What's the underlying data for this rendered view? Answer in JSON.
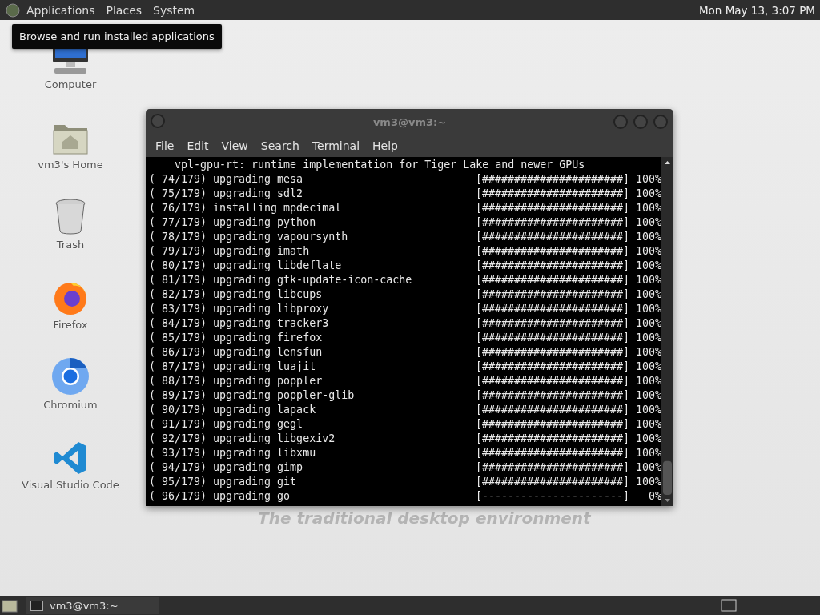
{
  "top_panel": {
    "menus": [
      {
        "label": "Applications",
        "selected": false
      },
      {
        "label": "Places",
        "selected": false
      },
      {
        "label": "System",
        "selected": false
      }
    ],
    "clock": "Mon May 13,  3:07 PM"
  },
  "tooltip": "Browse and run installed applications",
  "desktop_icons": [
    {
      "kind": "computer",
      "label": "Computer"
    },
    {
      "kind": "home",
      "label": "vm3's Home"
    },
    {
      "kind": "trash",
      "label": "Trash"
    },
    {
      "kind": "firefox",
      "label": "Firefox"
    },
    {
      "kind": "chromium",
      "label": "Chromium"
    },
    {
      "kind": "vscode",
      "label": "Visual Studio Code"
    }
  ],
  "wallpaper_text": "The traditional desktop environment",
  "terminal": {
    "title": "vm3@vm3:~",
    "menus": [
      "File",
      "Edit",
      "View",
      "Search",
      "Terminal",
      "Help"
    ],
    "header": "    vpl-gpu-rt: runtime implementation for Tiger Lake and newer GPUs",
    "lines": [
      {
        "text": "( 74/179) upgrading mesa",
        "bar": "[######################]",
        "percent": "100%"
      },
      {
        "text": "( 75/179) upgrading sdl2",
        "bar": "[######################]",
        "percent": "100%"
      },
      {
        "text": "( 76/179) installing mpdecimal",
        "bar": "[######################]",
        "percent": "100%"
      },
      {
        "text": "( 77/179) upgrading python",
        "bar": "[######################]",
        "percent": "100%"
      },
      {
        "text": "( 78/179) upgrading vapoursynth",
        "bar": "[######################]",
        "percent": "100%"
      },
      {
        "text": "( 79/179) upgrading imath",
        "bar": "[######################]",
        "percent": "100%"
      },
      {
        "text": "( 80/179) upgrading libdeflate",
        "bar": "[######################]",
        "percent": "100%"
      },
      {
        "text": "( 81/179) upgrading gtk-update-icon-cache",
        "bar": "[######################]",
        "percent": "100%"
      },
      {
        "text": "( 82/179) upgrading libcups",
        "bar": "[######################]",
        "percent": "100%"
      },
      {
        "text": "( 83/179) upgrading libproxy",
        "bar": "[######################]",
        "percent": "100%"
      },
      {
        "text": "( 84/179) upgrading tracker3",
        "bar": "[######################]",
        "percent": "100%"
      },
      {
        "text": "( 85/179) upgrading firefox",
        "bar": "[######################]",
        "percent": "100%"
      },
      {
        "text": "( 86/179) upgrading lensfun",
        "bar": "[######################]",
        "percent": "100%"
      },
      {
        "text": "( 87/179) upgrading luajit",
        "bar": "[######################]",
        "percent": "100%"
      },
      {
        "text": "( 88/179) upgrading poppler",
        "bar": "[######################]",
        "percent": "100%"
      },
      {
        "text": "( 89/179) upgrading poppler-glib",
        "bar": "[######################]",
        "percent": "100%"
      },
      {
        "text": "( 90/179) upgrading lapack",
        "bar": "[######################]",
        "percent": "100%"
      },
      {
        "text": "( 91/179) upgrading gegl",
        "bar": "[######################]",
        "percent": "100%"
      },
      {
        "text": "( 92/179) upgrading libgexiv2",
        "bar": "[######################]",
        "percent": "100%"
      },
      {
        "text": "( 93/179) upgrading libxmu",
        "bar": "[######################]",
        "percent": "100%"
      },
      {
        "text": "( 94/179) upgrading gimp",
        "bar": "[######################]",
        "percent": "100%"
      },
      {
        "text": "( 95/179) upgrading git",
        "bar": "[######################]",
        "percent": "100%"
      },
      {
        "text": "( 96/179) upgrading go",
        "bar": "[----------------------]",
        "percent": "0%"
      }
    ]
  },
  "taskbar": {
    "tasks": [
      {
        "label": "vm3@vm3:~",
        "selected": false
      }
    ]
  }
}
